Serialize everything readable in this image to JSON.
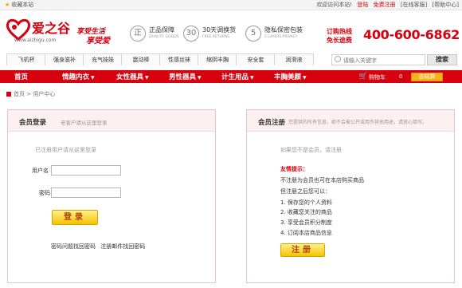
{
  "topbar": {
    "bookmark_label": "收藏本站",
    "welcome": "欢迎访问本站!",
    "login": "登陆",
    "register": "免费注册",
    "service": "[在线客服]",
    "help": "[帮助中心]"
  },
  "header": {
    "logo_text": "爱之谷",
    "logo_url": "www.aizhigu.com",
    "slogan_line1": "享受生活",
    "slogan_line2": "享受爱",
    "guarantees": [
      {
        "icon": "正",
        "title": "正品保障",
        "sub": "QUALITY GOODS"
      },
      {
        "icon": "30",
        "title": "30天调换货",
        "sub": "FREE RETURNS"
      },
      {
        "icon": "5",
        "title": "隐私保密包装",
        "sub": "5 LAYERS PRIVACY"
      }
    ],
    "hotline_label": "订购热线",
    "hotline_sub": "免长途费",
    "phone": "400-600-6862"
  },
  "categories": [
    "飞机杯",
    "强身滋补",
    "充气娃娃",
    "震动棒",
    "性感丝袜",
    "缩阴丰胸",
    "安全套",
    "润滑液"
  ],
  "search": {
    "placeholder": "请输入关键字",
    "button": "搜索"
  },
  "nav": {
    "items": [
      {
        "label": "首页",
        "has_arrow": false
      },
      {
        "label": "情趣内衣",
        "has_arrow": true
      },
      {
        "label": "女性器具",
        "has_arrow": true
      },
      {
        "label": "男性器具",
        "has_arrow": true
      },
      {
        "label": "计生用品",
        "has_arrow": true
      },
      {
        "label": "丰胸美颜",
        "has_arrow": true
      }
    ],
    "cart_label": "购物车",
    "cart_count": "0",
    "checkout": "去结算"
  },
  "breadcrumb": {
    "home": "首页",
    "sep": ">",
    "current": "用户中心",
    "text": "首页 > 用户中心"
  },
  "login_panel": {
    "title": "会员登录",
    "subtitle": "老客户请从这里登录",
    "hint": "已注册用户请从这里登录",
    "username_label": "用户名",
    "password_label": "密码",
    "username_value": "",
    "password_value": "",
    "login_button": "登录",
    "recover_q": "密码问题找回密码",
    "recover_mail": "注册邮件找回密码"
  },
  "register_panel": {
    "title": "会员注册",
    "subtitle": "您提供的所有信息，绝不会被公开或用作其他用途，请放心填写。",
    "hint": "如果您不是会员，请注册",
    "tip_title": "友情提示：",
    "tips": [
      "不注册为会员也可在本店购买商品",
      "但注册之后您可以：",
      "1. 保存您的个人资料",
      "2. 收藏您关注的商品",
      "3. 享受会员积分制度",
      "4. 订阅本店商品信息"
    ],
    "register_button": "注册"
  },
  "colors": {
    "brand": "#d6000f",
    "accent_yellow": "#f4c200",
    "panel_border": "#e1c4c6"
  }
}
